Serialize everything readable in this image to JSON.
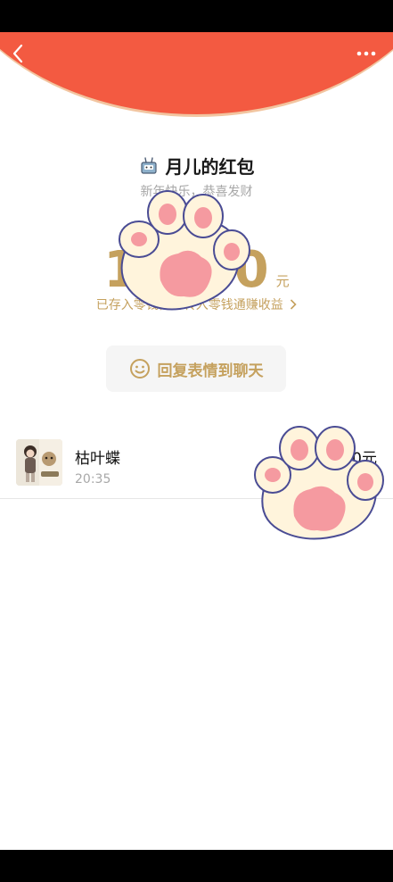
{
  "title": "月儿的红包",
  "blessing": "新年快乐，恭喜发财",
  "amount": "18.00",
  "currency": "元",
  "saved_note": "已存入零钱，可转入零钱通赚收益",
  "reply_label": "回复表情到聊天",
  "record": {
    "name": "枯叶蝶",
    "time": "20:35",
    "amount": "18.00元"
  },
  "colors": {
    "header_red": "#f35a41",
    "gold": "#c5a15e",
    "paw_fill": "#fff4dc",
    "paw_pad": "#f59aa0",
    "paw_outline": "#4a4c94"
  },
  "icons": [
    "back-icon",
    "more-icon",
    "sender-sticker-icon",
    "smiley-icon",
    "paw-sticker"
  ]
}
